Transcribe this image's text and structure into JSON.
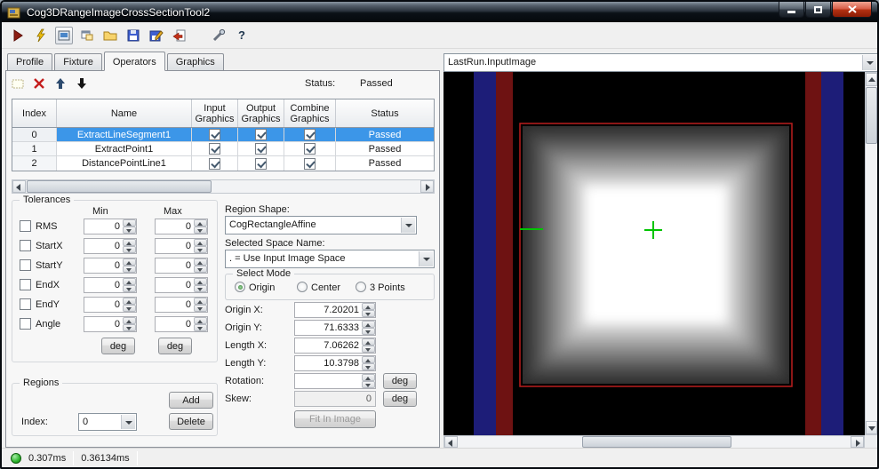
{
  "window": {
    "title": "Cog3DRangeImageCrossSectionTool2"
  },
  "toolbar": {
    "help_label": "?"
  },
  "tabs": {
    "items": [
      {
        "label": "Profile"
      },
      {
        "label": "Fixture"
      },
      {
        "label": "Operators"
      },
      {
        "label": "Graphics"
      }
    ]
  },
  "operators": {
    "status_label": "Status:",
    "status_value": "Passed",
    "grid": {
      "headers": {
        "index": "Index",
        "name": "Name",
        "input": "Input Graphics",
        "output": "Output Graphics",
        "combine": "Combine Graphics",
        "status": "Status"
      },
      "rows": [
        {
          "index": "0",
          "name": "ExtractLineSegment1",
          "input_checked": true,
          "output_checked": true,
          "combine_checked": true,
          "status": "Passed",
          "selected": true
        },
        {
          "index": "1",
          "name": "ExtractPoint1",
          "input_checked": true,
          "output_checked": true,
          "combine_checked": true,
          "status": "Passed",
          "selected": false
        },
        {
          "index": "2",
          "name": "DistancePointLine1",
          "input_checked": true,
          "output_checked": true,
          "combine_checked": true,
          "status": "Passed",
          "selected": false
        }
      ]
    }
  },
  "tolerances": {
    "title": "Tolerances",
    "min_header": "Min",
    "max_header": "Max",
    "rows": [
      {
        "label": "RMS",
        "min": "0",
        "max": "0"
      },
      {
        "label": "StartX",
        "min": "0",
        "max": "0"
      },
      {
        "label": "StartY",
        "min": "0",
        "max": "0"
      },
      {
        "label": "EndX",
        "min": "0",
        "max": "0"
      },
      {
        "label": "EndY",
        "min": "0",
        "max": "0"
      },
      {
        "label": "Angle",
        "min": "0",
        "max": "0"
      }
    ],
    "min_unit": "deg",
    "max_unit": "deg"
  },
  "regions": {
    "title": "Regions",
    "index_label": "Index:",
    "index_value": "0",
    "add_button": "Add",
    "delete_button": "Delete"
  },
  "region_editor": {
    "shape_label": "Region Shape:",
    "shape_value": "CogRectangleAffine",
    "space_label": "Selected Space Name:",
    "space_value": ". = Use Input Image Space",
    "mode_title": "Select Mode",
    "modes": [
      {
        "label": "Origin",
        "selected": true
      },
      {
        "label": "Center",
        "selected": false
      },
      {
        "label": "3 Points",
        "selected": false
      }
    ],
    "origin_x_label": "Origin X:",
    "origin_x_value": "7.20201",
    "origin_y_label": "Origin Y:",
    "origin_y_value": "71.6333",
    "length_x_label": "Length X:",
    "length_x_value": "7.06262",
    "length_y_label": "Length Y:",
    "length_y_value": "10.3798",
    "rotation_label": "Rotation:",
    "rotation_value": "",
    "rotation_unit": "deg",
    "skew_label": "Skew:",
    "skew_value": "0",
    "skew_unit": "deg",
    "fit_button": "Fit In Image"
  },
  "image_panel": {
    "source_selector": "LastRun.InputImage",
    "colors": {
      "background": "#000000",
      "stripe_blue": "#1d1d78",
      "stripe_red": "#6e1212",
      "selection_red": "#bb1e1e",
      "crosshair_green": "#00c400"
    }
  },
  "status_bar": {
    "run_time": "0.307ms",
    "total_time": "0.36134ms"
  }
}
